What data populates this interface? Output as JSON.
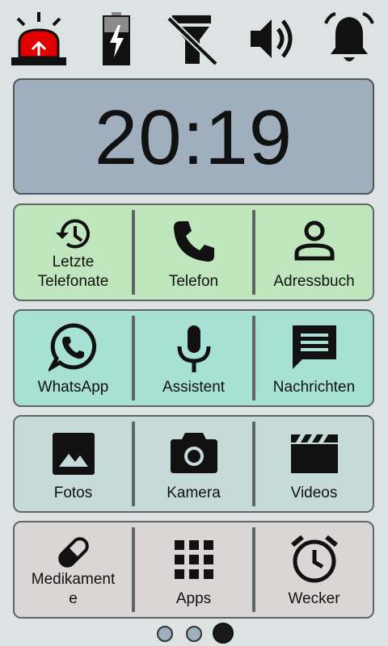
{
  "status_bar": {
    "icons": [
      "emergency-light-icon",
      "battery-charging-icon",
      "flashlight-off-icon",
      "volume-icon",
      "bell-icon"
    ]
  },
  "clock": {
    "time": "20:19"
  },
  "rows": [
    {
      "color": "#bfe6bc",
      "tiles": [
        {
          "label": "Letzte\nTelefonate",
          "icon": "history-icon"
        },
        {
          "label": "Telefon",
          "icon": "phone-icon"
        },
        {
          "label": "Adressbuch",
          "icon": "person-icon"
        }
      ]
    },
    {
      "color": "#a6e1d3",
      "tiles": [
        {
          "label": "WhatsApp",
          "icon": "whatsapp-icon"
        },
        {
          "label": "Assistent",
          "icon": "microphone-icon"
        },
        {
          "label": "Nachrichten",
          "icon": "message-icon"
        }
      ]
    },
    {
      "color": "#c6dada",
      "tiles": [
        {
          "label": "Fotos",
          "icon": "image-icon"
        },
        {
          "label": "Kamera",
          "icon": "camera-icon"
        },
        {
          "label": "Videos",
          "icon": "clapperboard-icon"
        }
      ]
    },
    {
      "color": "#d9d6d5",
      "tiles": [
        {
          "label": "Medikament\ne",
          "icon": "pill-icon"
        },
        {
          "label": "Apps",
          "icon": "apps-grid-icon"
        },
        {
          "label": "Wecker",
          "icon": "alarm-clock-icon"
        }
      ]
    }
  ],
  "pagination": {
    "current_page": 3,
    "total_pages": 3
  }
}
